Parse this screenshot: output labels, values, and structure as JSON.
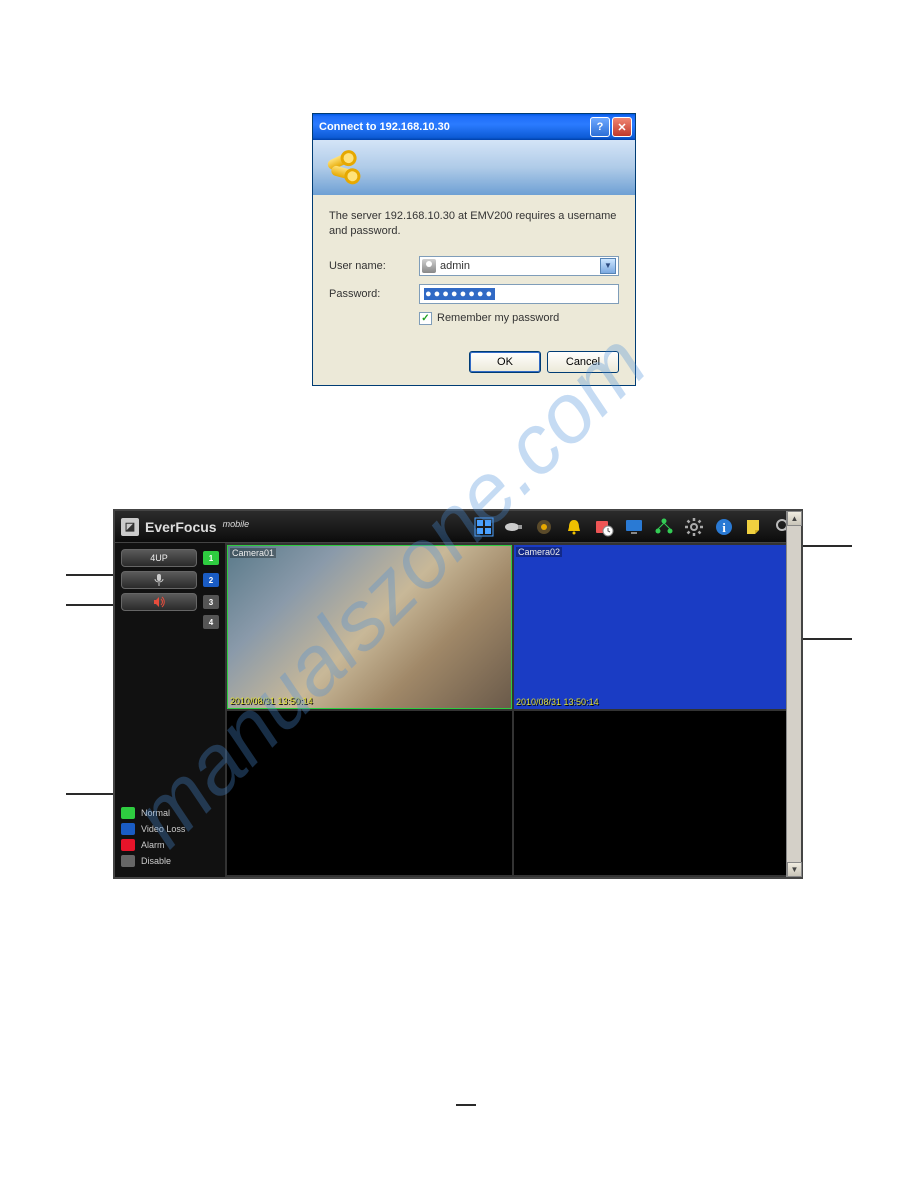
{
  "dialog": {
    "title": "Connect to 192.168.10.30",
    "message": "The server 192.168.10.30 at  EMV200 requires a username and password.",
    "labels": {
      "username": "User name:",
      "password": "Password:",
      "remember": "Remember my password"
    },
    "username_value": "admin",
    "password_masked": "●●●●●●●●",
    "ok": "OK",
    "cancel": "Cancel"
  },
  "viewer": {
    "brand": "EverFocus",
    "brand_sup": "mobile",
    "fourup_label": "4UP",
    "channels": [
      "1",
      "2",
      "3",
      "4"
    ],
    "cam1_label": "Camera01",
    "cam1_time": "2010/08/31  13:50:14",
    "cam2_label": "Camera02",
    "cam2_time": "2010/08/31  13:50:14",
    "legend": {
      "normal": "Normal",
      "videoloss": "Video Loss",
      "alarm": "Alarm",
      "disable": "Disable"
    }
  },
  "icons": {
    "grid": "grid-icon",
    "camera": "camera-icon",
    "record": "record-icon",
    "bell": "bell-icon",
    "schedule": "schedule-icon",
    "monitor": "monitor-icon",
    "network": "network-icon",
    "gear": "gear-icon",
    "info": "info-icon",
    "note": "note-icon",
    "search": "search-icon"
  }
}
